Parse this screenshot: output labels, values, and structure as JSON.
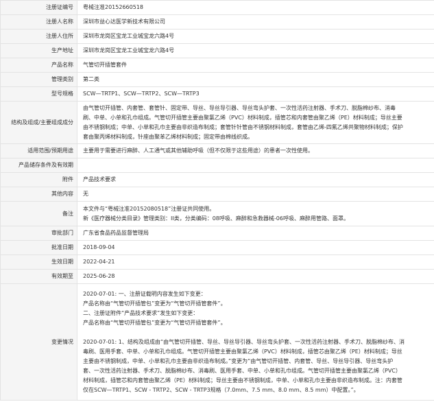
{
  "rows": [
    {
      "label": "注册证编号",
      "value": [
        "粤械注准20152660518"
      ]
    },
    {
      "label": "注册人名称",
      "value": [
        "深圳市益心达医学新技术有限公司"
      ]
    },
    {
      "label": "注册人住所",
      "value": [
        "深圳市龙岗区宝龙工业城宝龙六路4号"
      ]
    },
    {
      "label": "生产地址",
      "value": [
        "深圳市龙岗区宝龙工业城宝龙六路4号"
      ]
    },
    {
      "label": "产品名称",
      "value": [
        "气管切开插管套件"
      ]
    },
    {
      "label": "管理类别",
      "value": [
        "第二类"
      ]
    },
    {
      "label": "型号规格",
      "value": [
        "SCW—TRTP1、SCW—TRTP2、SCW—TRTP3"
      ]
    },
    {
      "label": "结构及组成/主要组成成分",
      "value": [
        "由气管切开插管、内套管、套管针、固定带、导丝、导丝导引器、导丝弯头护套、一次性活药注射器、手术刀、脱脂棉纱布、消毒",
        "刷、中单、小单和孔巾组成。气管切开插管主要由聚氯乙烯（PVC）材料制成，插管芯和内套管由聚乙烯（PE）材料制成；导丝主要",
        "由不锈钢制成；中单、小单和孔巾主要由非织造布制成；套管针针管由不锈钢材料制成，套管由乙烯-四氟乙烯共聚物材料制成；保护",
        "套由聚丙烯材料制成，针座由聚苯乙烯材料制成；固定带由棉线织成。"
      ]
    },
    {
      "label": "适用范围/预期用途",
      "value": [
        "主要用于需要进行麻醉、人工通气或其他辅助呼吸（但不仅限于这些用途）的患者一次性使用。"
      ]
    },
    {
      "label": "产品储存条件及有效期",
      "value": [
        ""
      ]
    },
    {
      "label": "附件",
      "value": [
        "产品技术要求"
      ]
    },
    {
      "label": "其他内容",
      "value": [
        "无"
      ]
    },
    {
      "label": "备注",
      "value": [
        "本文件与“粤械注准20152080518”注册证共同使用。",
        "新《医疗器械分类目录》管理类别：II类，分类编码：08呼吸、麻醉和急救器械-06呼吸、麻醉用管路、面罩。"
      ]
    },
    {
      "label": "审批部门",
      "value": [
        "广东省食品药品监督管理局"
      ]
    },
    {
      "label": "批准日期",
      "value": [
        "2018-09-04"
      ]
    },
    {
      "label": "生效日期",
      "value": [
        "2022-04-21"
      ]
    },
    {
      "label": "有效期至",
      "value": [
        "2025-06-28"
      ]
    },
    {
      "label": "变更情况",
      "value": [
        "2020-07-01: 一、注册证载明内容发生如下变更：",
        "产品名称由“气管切开插管包”变更为“气管切开插管套件”。",
        "二、注册证附件“产品技术要求”发生如下变更：",
        "产品名称由“气管切开插管包”变更为“气管切开插管套件”。",
        "",
        "2020-07-01: 1、结构及组成由“由气管切开插管、导丝、导丝导引器、导丝弯头护套、一次性活药注射器、手术刀、脱脂棉纱布、消",
        "毒刷、医用手套、中单、小单和孔巾组成。气管切开插管主要由聚氯乙烯（PVC）材料制成，插管芯由聚乙烯（PE）材料制成；导丝",
        "主要由不锈钢制成，中单、小单和孔巾主要由非织造布制成。”变更为“由气管切开插管、内套管、导丝、导丝导引器、导丝弯头护",
        "套、一次性活药注射器、手术刀、脱脂棉纱布、消毒刷、医用手套、中单、小单和孔巾组成。气管切开插管主要由聚氯乙烯（PVC）",
        "材料制成，插管芯和内套管由聚乙烯（PE）材料制成；导丝主要由不锈钢制成，中单、小单和孔巾主要由非织造布制成。注：内套管",
        "仅在SCW—TRTP1、SCW - TRTP2、SCW - TRTP3规格（7.0mm、7.5 mm、8.0 mm、8.5 mm）中配置。”。"
      ]
    }
  ]
}
